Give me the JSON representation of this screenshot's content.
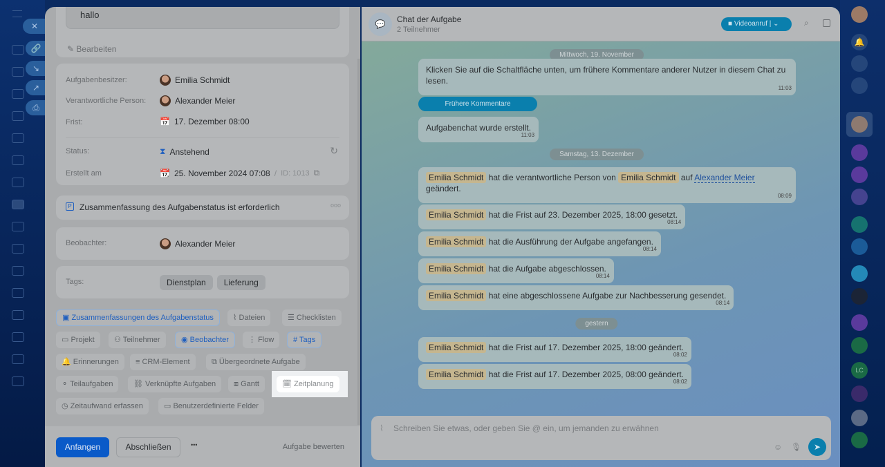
{
  "left_sidebar": {
    "close_label": "✕"
  },
  "task": {
    "description": "hallo",
    "edit_label": "Bearbeiten",
    "fields": [
      {
        "label": "Aufgabenbesitzer:",
        "value": "Emilia Schmidt"
      },
      {
        "label": "Verantwortliche Person:",
        "value": "Alexander Meier"
      },
      {
        "label": "Frist:",
        "value": "17. Dezember 08:00"
      },
      {
        "label": "Status:",
        "value": "Anstehend"
      },
      {
        "label": "Erstellt am",
        "value": "25. November 2024 07:08",
        "id": "ID: 1013"
      }
    ],
    "summary_required": "Zusammenfassung des Aufgabenstatus ist erforderlich",
    "observer_label": "Beobachter:",
    "observer": "Alexander Meier",
    "tags_label": "Tags:",
    "tags": [
      "Dienstplan",
      "Lieferung"
    ],
    "chips": [
      "Zusammenfassungen des Aufgabenstatus",
      "Dateien",
      "Checklisten",
      "Projekt",
      "Teilnehmer",
      "Beobachter",
      "Flow",
      "Tags",
      "Erinnerungen",
      "CRM-Element",
      "Übergeordnete Aufgabe",
      "Teilaufgaben",
      "Verknüpfte Aufgaben",
      "Gantt",
      "Zeitplanung",
      "Zeitaufwand erfassen",
      "Benutzerdefinierte Felder"
    ],
    "footer": {
      "start": "Anfangen",
      "complete": "Abschließen",
      "more": "•••",
      "rate": "Aufgabe bewerten"
    }
  },
  "chat": {
    "title": "Chat der Aufgabe",
    "subtitle": "2 Teilnehmer",
    "video": "Videoanruf",
    "dates": [
      "Mittwoch, 19. November",
      "Samstag, 13. Dezember",
      "gestern"
    ],
    "intro": "Klicken Sie auf die Schaltfläche unten, um frühere Kommentare anderer Nutzer in diesem Chat zu lesen.",
    "intro_time": "11:03",
    "earlier_button": "Frühere Kommentare",
    "created": "Aufgabenchat wurde erstellt.",
    "created_time": "11:03",
    "messages": [
      {
        "user": "Emilia Schmidt",
        "text": "hat die verantwortliche Person von",
        "user2": "Emilia Schmidt",
        "text2": "auf",
        "link": "Alexander Meier",
        "text3": "geändert.",
        "time": "08:09"
      },
      {
        "user": "Emilia Schmidt",
        "text": "hat die Frist auf 23. Dezember 2025, 18:00 gesetzt.",
        "time": "08:14"
      },
      {
        "user": "Emilia Schmidt",
        "text": "hat die Ausführung der Aufgabe angefangen.",
        "time": "08:14"
      },
      {
        "user": "Emilia Schmidt",
        "text": "hat die Aufgabe abgeschlossen.",
        "time": "08:14"
      },
      {
        "user": "Emilia Schmidt",
        "text": "hat eine abgeschlossene Aufgabe zur Nachbesserung gesendet.",
        "time": "08:14"
      },
      {
        "user": "Emilia Schmidt",
        "text": "hat die Frist auf 17. Dezember 2025, 18:00 geändert.",
        "time": "08:02"
      },
      {
        "user": "Emilia Schmidt",
        "text": "hat die Frist auf 17. Dezember 2025, 08:00 geändert.",
        "time": "08:02"
      }
    ],
    "input_placeholder": "Schreiben Sie etwas, oder geben Sie @ ein, um jemanden zu erwähnen"
  },
  "right_sidebar": {
    "lc_label": "LC"
  }
}
